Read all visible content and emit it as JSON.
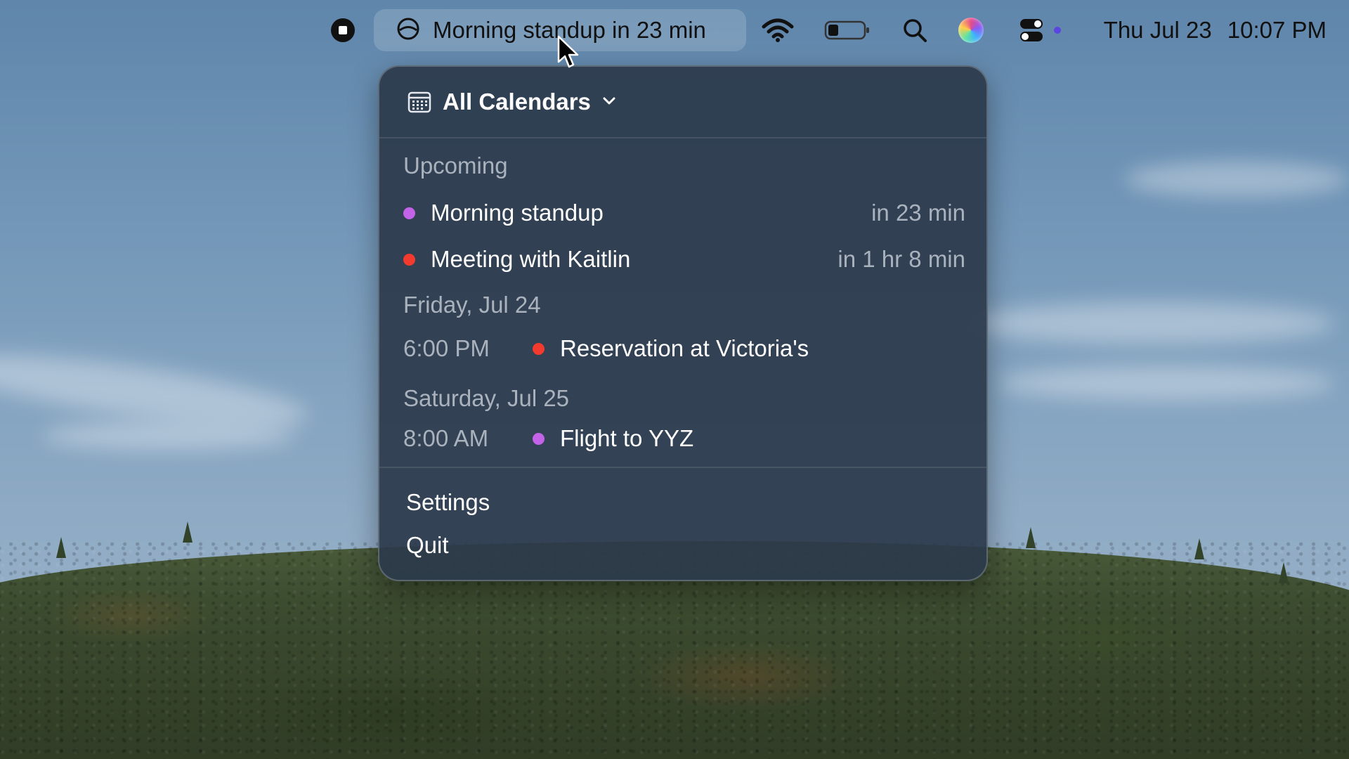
{
  "menubar": {
    "active_event_label": "Morning standup in 23 min",
    "date": "Thu Jul 23",
    "time": "10:07 PM",
    "icons": [
      "screen-record-icon",
      "calendar-progress-icon",
      "wifi-icon",
      "battery-icon",
      "search-icon",
      "siri-icon",
      "control-center-icon"
    ],
    "battery_level": 0.3
  },
  "panel": {
    "header": {
      "title": "All Calendars",
      "icon": "calendar-grid-icon",
      "chevron": "chevron-down-icon"
    },
    "upcoming": {
      "heading": "Upcoming",
      "events": [
        {
          "name": "Morning standup",
          "relative": "in 23 min",
          "color": "#c364e8"
        },
        {
          "name": "Meeting with Kaitlin",
          "relative": "in 1 hr 8 min",
          "color": "#f23a2e"
        }
      ]
    },
    "days": [
      {
        "heading": "Friday, Jul 24",
        "events": [
          {
            "time": "6:00 PM",
            "name": "Reservation at Victoria's",
            "color": "#f23a2e"
          }
        ]
      },
      {
        "heading": "Saturday, Jul 25",
        "events": [
          {
            "time": "8:00 AM",
            "name": "Flight to YYZ",
            "color": "#c364e8"
          }
        ]
      }
    ],
    "menu": {
      "settings": "Settings",
      "quit": "Quit"
    }
  }
}
